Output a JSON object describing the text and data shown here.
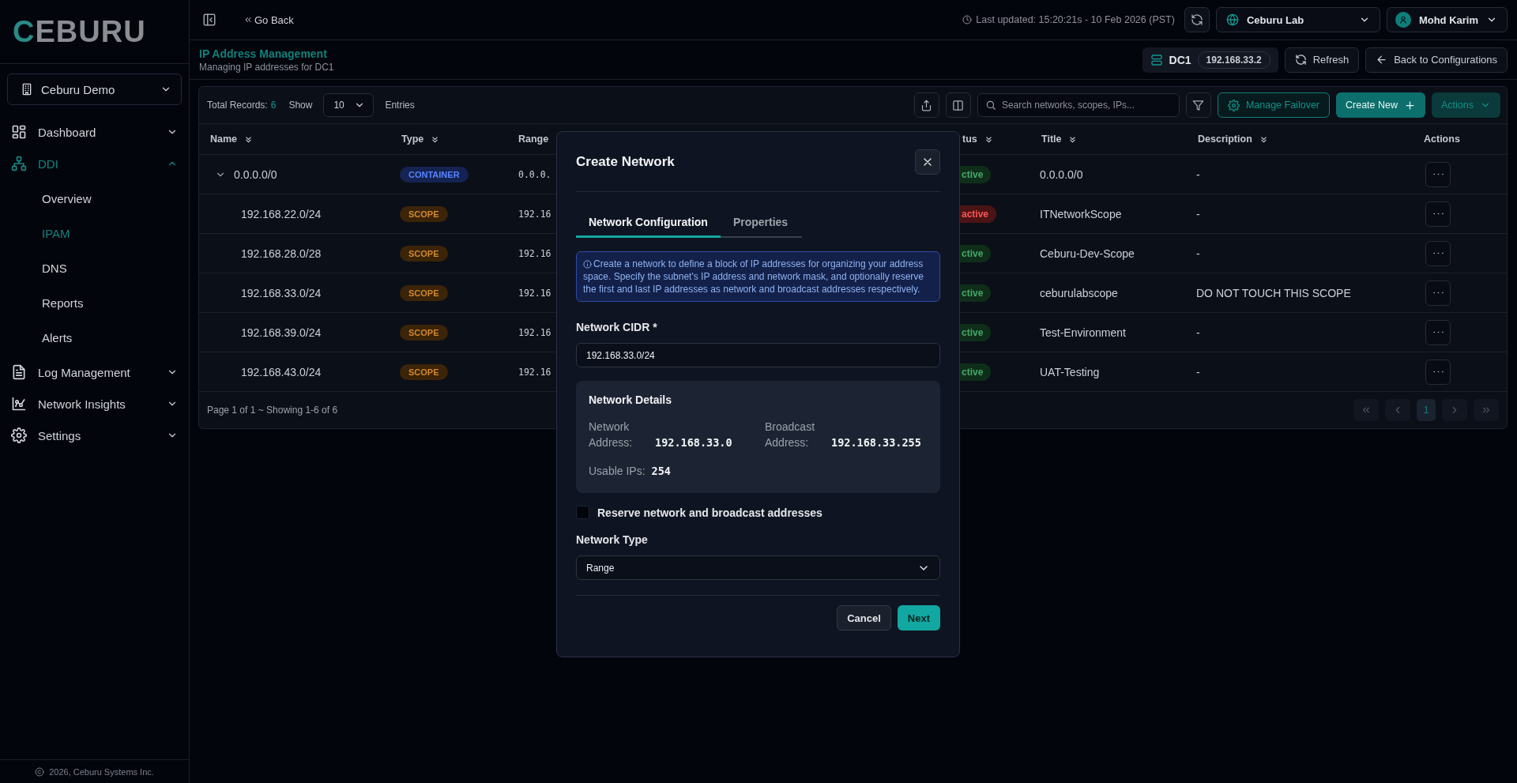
{
  "sidebar": {
    "logo": "CEBURU",
    "org": "Ceburu Demo",
    "items": [
      {
        "label": "Dashboard",
        "expanded": false,
        "selected": false
      },
      {
        "label": "DDI",
        "expanded": true,
        "selected": true,
        "children": [
          {
            "label": "Overview",
            "selected": false
          },
          {
            "label": "IPAM",
            "selected": true
          },
          {
            "label": "DNS",
            "selected": false
          },
          {
            "label": "Reports",
            "selected": false
          },
          {
            "label": "Alerts",
            "selected": false
          }
        ]
      },
      {
        "label": "Log Management",
        "expanded": false,
        "selected": false
      },
      {
        "label": "Network Insights",
        "expanded": false,
        "selected": false
      },
      {
        "label": "Settings",
        "expanded": false,
        "selected": false
      }
    ],
    "footer": "2026, Ceburu Systems Inc."
  },
  "topbar": {
    "back": "Go Back",
    "last_updated": "Last updated: 15:20:21s - 10 Feb 2026 (PST)",
    "site": "Ceburu Lab",
    "user": "Mohd Karim"
  },
  "header": {
    "title": "IP Address Management",
    "subtitle": "Managing IP addresses for DC1",
    "server": "DC1",
    "server_ip": "192.168.33.2",
    "refresh": "Refresh",
    "back": "Back to Configurations"
  },
  "toolbar": {
    "total_label": "Total Records:",
    "total": "6",
    "show": "Show",
    "page_size": "10",
    "entries": "Entries",
    "search_placeholder": "Search networks, scopes, IPs...",
    "failover": "Manage Failover",
    "create": "Create New",
    "actions": "Actions"
  },
  "table": {
    "columns": [
      {
        "label": "Name",
        "sortable": true
      },
      {
        "label": "Type",
        "sortable": true
      },
      {
        "label": "Range",
        "sortable": false
      },
      {
        "label": "tus",
        "sortable": true
      },
      {
        "label": "Title",
        "sortable": true
      },
      {
        "label": "Description",
        "sortable": true
      },
      {
        "label": "Actions",
        "sortable": false
      }
    ],
    "rows": [
      {
        "name": "0.0.0.0/0",
        "type": {
          "label": "CONTAINER",
          "color": "#152352"
        },
        "range": "0.0.0.",
        "status": {
          "label": "ctive",
          "color": "#0f2e1a"
        },
        "title": "0.0.0.0/0",
        "description": "-",
        "expanded": true,
        "children": [
          {
            "name": "192.168.22.0/24",
            "type": {
              "label": "SCOPE",
              "color": "#3b2408"
            },
            "range": "192.16",
            "status": {
              "label": "active",
              "color": "#4a1414"
            },
            "title": "ITNetworkScope",
            "description": "-"
          },
          {
            "name": "192.168.28.0/28",
            "type": {
              "label": "SCOPE",
              "color": "#3b2408"
            },
            "range": "192.16",
            "status": {
              "label": "ctive",
              "color": "#0f2e1a"
            },
            "title": "Ceburu-Dev-Scope",
            "description": "-"
          },
          {
            "name": "192.168.33.0/24",
            "type": {
              "label": "SCOPE",
              "color": "#3b2408"
            },
            "range": "192.16",
            "status": {
              "label": "ctive",
              "color": "#0f2e1a"
            },
            "title": "ceburulabscope",
            "description": "DO NOT TOUCH THIS SCOPE"
          },
          {
            "name": "192.168.39.0/24",
            "type": {
              "label": "SCOPE",
              "color": "#3b2408"
            },
            "range": "192.16",
            "status": {
              "label": "ctive",
              "color": "#0f2e1a"
            },
            "title": "Test-Environment",
            "description": "-"
          },
          {
            "name": "192.168.43.0/24",
            "type": {
              "label": "SCOPE",
              "color": "#3b2408"
            },
            "range": "192.16",
            "status": {
              "label": "ctive",
              "color": "#0f2e1a"
            },
            "title": "UAT-Testing",
            "description": "-"
          }
        ]
      }
    ],
    "summary": "Page 1 of 1 ~ Showing 1-6 of 6",
    "pages": [
      {
        "label": "1",
        "selected": true
      }
    ]
  },
  "modal": {
    "title": "Create Network",
    "tabs": [
      {
        "label": "Network Configuration",
        "selected": true
      },
      {
        "label": "Properties",
        "selected": false
      }
    ],
    "info": "Create a network to define a block of IP addresses for organizing your address space. Specify the subnet's IP address and network mask, and optionally reserve the first and last IP addresses as network and broadcast addresses respectively.",
    "cidr_label": "Network CIDR *",
    "cidr_value": "192.168.33.0/24",
    "details": {
      "title": "Network Details",
      "network_label": "Network Address:",
      "network_value": "192.168.33.0",
      "broadcast_label": "Broadcast Address:",
      "broadcast_value": "192.168.33.255",
      "usable_label": "Usable IPs:",
      "usable_value": "254"
    },
    "reserve": {
      "label": "Reserve network and broadcast addresses",
      "checked": false
    },
    "type_label": "Network Type",
    "type_value": "Range",
    "buttons": [
      {
        "label": "Cancel",
        "kind": "secondary"
      },
      {
        "label": "Next",
        "kind": "primary"
      }
    ]
  }
}
